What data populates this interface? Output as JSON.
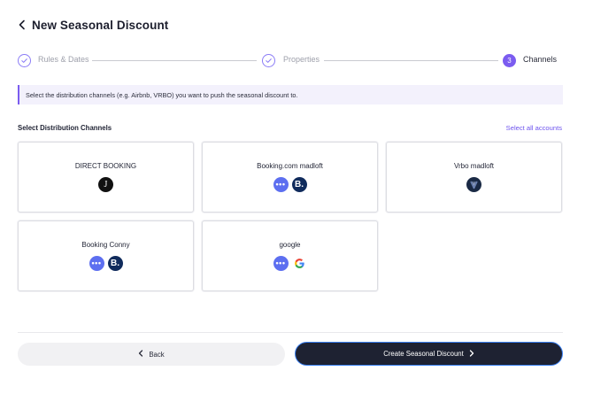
{
  "header": {
    "title": "New Seasonal Discount"
  },
  "stepper": {
    "steps": [
      {
        "label": "Rules & Dates",
        "status": "done"
      },
      {
        "label": "Properties",
        "status": "done"
      },
      {
        "label": "Channels",
        "status": "active",
        "number": "3"
      }
    ]
  },
  "banner": {
    "text": "Select the distribution channels (e.g. Airbnb, VRBO) you want to push the seasonal discount to."
  },
  "channels_section": {
    "title": "Select Distribution Channels",
    "select_all_label": "Select all accounts"
  },
  "channels": [
    {
      "name": "DIRECT BOOKING",
      "icons": [
        "direct-booking-icon"
      ]
    },
    {
      "name": "Booking.com madloft",
      "icons": [
        "more-dots-icon",
        "booking-com-icon"
      ]
    },
    {
      "name": "Vrbo madloft",
      "icons": [
        "vrbo-icon"
      ]
    },
    {
      "name": "Booking Conny",
      "icons": [
        "more-dots-icon",
        "booking-com-icon"
      ]
    },
    {
      "name": "google",
      "icons": [
        "more-dots-icon",
        "google-icon"
      ]
    }
  ],
  "icon_glyphs": {
    "direct": "J",
    "booking": "B.",
    "dots": "•••"
  },
  "footer": {
    "back_label": "Back",
    "create_label": "Create Seasonal Discount"
  },
  "colors": {
    "accent": "#7b5cf0",
    "link": "#6e54ee",
    "primary_button": "#1e2232",
    "dots_badge": "#5d6ff0",
    "booking_badge": "#102b5c"
  }
}
